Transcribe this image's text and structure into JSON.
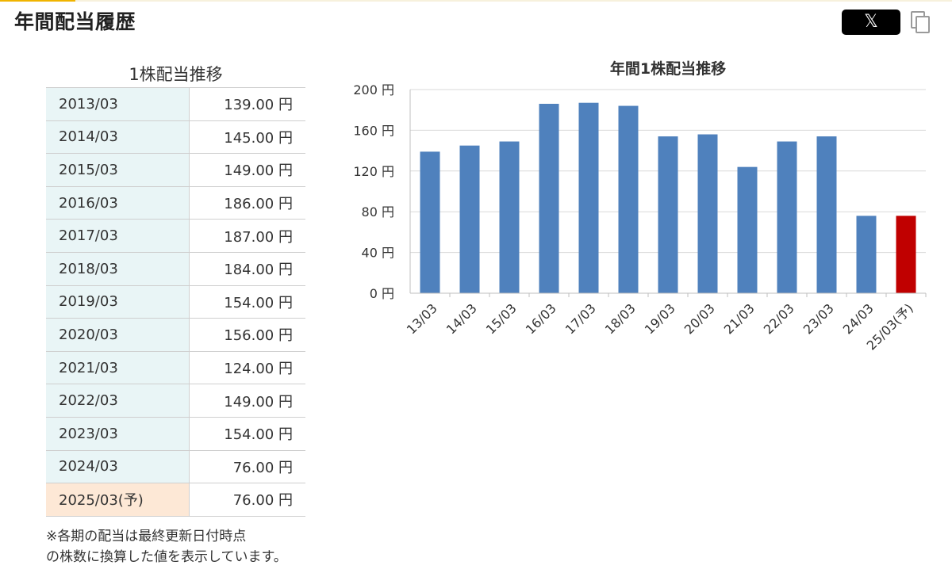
{
  "header": {
    "title": "年間配当履歴",
    "share_label": "𝕏",
    "copy_icon": "copy-icon"
  },
  "table": {
    "title": "1株配当推移",
    "rows": [
      {
        "period": "2013/03",
        "amount": "139.00 円"
      },
      {
        "period": "2014/03",
        "amount": "145.00 円"
      },
      {
        "period": "2015/03",
        "amount": "149.00 円"
      },
      {
        "period": "2016/03",
        "amount": "186.00 円"
      },
      {
        "period": "2017/03",
        "amount": "187.00 円"
      },
      {
        "period": "2018/03",
        "amount": "184.00 円"
      },
      {
        "period": "2019/03",
        "amount": "154.00 円"
      },
      {
        "period": "2020/03",
        "amount": "156.00 円"
      },
      {
        "period": "2021/03",
        "amount": "124.00 円"
      },
      {
        "period": "2022/03",
        "amount": "149.00 円"
      },
      {
        "period": "2023/03",
        "amount": "154.00 円"
      },
      {
        "period": "2024/03",
        "amount": "76.00 円"
      },
      {
        "period": "2025/03(予)",
        "amount": "76.00 円",
        "forecast": true
      }
    ],
    "note_line1": "※各期の配当は最終更新日付時点",
    "note_line2": "の株数に換算した値を表示しています。"
  },
  "chart_data": {
    "type": "bar",
    "title": "年間1株配当推移",
    "categories": [
      "13/03",
      "14/03",
      "15/03",
      "16/03",
      "17/03",
      "18/03",
      "19/03",
      "20/03",
      "21/03",
      "22/03",
      "23/03",
      "24/03",
      "25/03(予)"
    ],
    "values": [
      139,
      145,
      149,
      186,
      187,
      184,
      154,
      156,
      124,
      149,
      154,
      76,
      76
    ],
    "ylim": [
      0,
      200
    ],
    "yticks": [
      0,
      40,
      80,
      120,
      160,
      200
    ],
    "ytick_labels": [
      "0 円",
      "40 円",
      "80 円",
      "120 円",
      "160 円",
      "200 円"
    ],
    "grid": true,
    "colors": {
      "actual": "#4f81bd",
      "forecast": "#c00000"
    },
    "forecast_index": 12
  }
}
